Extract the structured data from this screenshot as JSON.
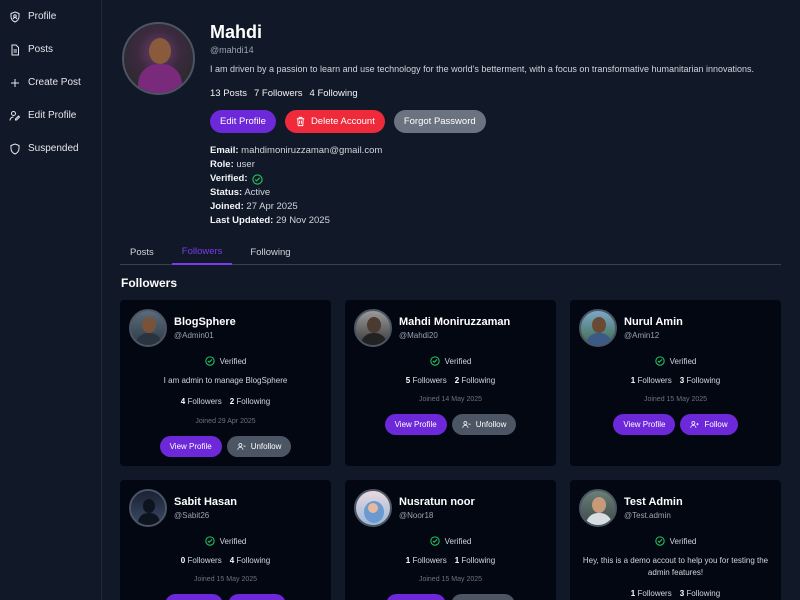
{
  "sidebar": {
    "items": [
      {
        "label": "Profile",
        "icon": "shield-user-icon"
      },
      {
        "label": "Posts",
        "icon": "document-icon"
      },
      {
        "label": "Create Post",
        "icon": "plus-icon"
      },
      {
        "label": "Edit Profile",
        "icon": "user-edit-icon"
      },
      {
        "label": "Suspended",
        "icon": "shield-icon"
      }
    ]
  },
  "profile": {
    "name": "Mahdi",
    "handle": "@mahdi14",
    "bio": "I am driven by a passion to learn and use technology for the world's betterment, with a focus on transformative humanitarian innovations.",
    "posts": "13 Posts",
    "followers": "7 Followers",
    "following": "4 Following",
    "buttons": {
      "edit": "Edit Profile",
      "delete": "Delete Account",
      "forgot": "Forgot Password"
    },
    "details": {
      "email_label": "Email:",
      "email": "mahdimoniruzzaman@gmail.com",
      "role_label": "Role:",
      "role": "user",
      "verified_label": "Verified:",
      "status_label": "Status:",
      "status": "Active",
      "joined_label": "Joined:",
      "joined": "27 Apr 2025",
      "updated_label": "Last Updated:",
      "updated": "29 Nov 2025"
    }
  },
  "tabs": [
    {
      "label": "Posts"
    },
    {
      "label": "Followers"
    },
    {
      "label": "Following"
    }
  ],
  "section_title": "Followers",
  "colors": {
    "accent": "#6d28d9",
    "danger": "#ef2b3b",
    "verified": "#22c55e",
    "background": "#111827",
    "card": "#030712"
  },
  "cards": [
    {
      "name": "BlogSphere",
      "handle": "@Admin01",
      "verified": "Verified",
      "bio": "I am admin to manage BlogSphere",
      "followers_n": "4",
      "followers_l": "Followers",
      "following_n": "2",
      "following_l": "Following",
      "joined": "Joined 29 Apr 2025",
      "view": "View Profile",
      "action": "Unfollow"
    },
    {
      "name": "Mahdi Moniruzzaman",
      "handle": "@Mahdi20",
      "verified": "Verified",
      "bio": "",
      "followers_n": "5",
      "followers_l": "Followers",
      "following_n": "2",
      "following_l": "Following",
      "joined": "Joined 14 May 2025",
      "view": "View Profile",
      "action": "Unfollow"
    },
    {
      "name": "Nurul Amin",
      "handle": "@Amin12",
      "verified": "Verified",
      "bio": "",
      "followers_n": "1",
      "followers_l": "Followers",
      "following_n": "3",
      "following_l": "Following",
      "joined": "Joined 15 May 2025",
      "view": "View Profile",
      "action": "Follow"
    },
    {
      "name": "Sabit Hasan",
      "handle": "@Sabit26",
      "verified": "Verified",
      "bio": "",
      "followers_n": "0",
      "followers_l": "Followers",
      "following_n": "4",
      "following_l": "Following",
      "joined": "Joined 15 May 2025"
    },
    {
      "name": "Nusratun noor",
      "handle": "@Noor18",
      "verified": "Verified",
      "bio": "",
      "followers_n": "1",
      "followers_l": "Followers",
      "following_n": "1",
      "following_l": "Following",
      "joined": "Joined 15 May 2025"
    },
    {
      "name": "Test Admin",
      "handle": "@Test.admin",
      "verified": "Verified",
      "bio": "Hey, this is a demo accout to help you for testing the admin features!",
      "followers_n": "1",
      "followers_l": "Followers",
      "following_n": "3",
      "following_l": "Following"
    }
  ]
}
